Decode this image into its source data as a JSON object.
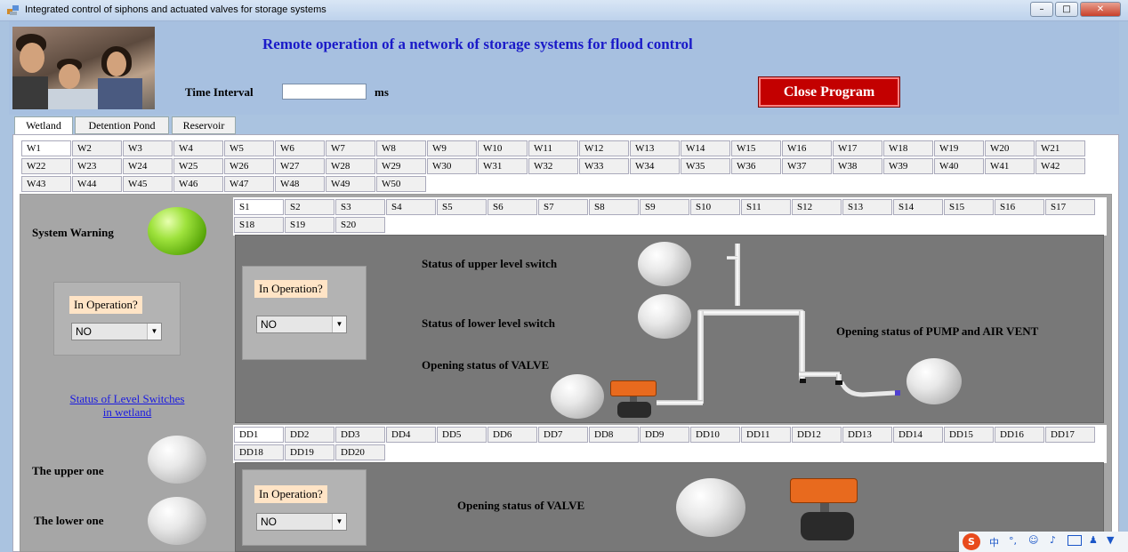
{
  "window": {
    "title": "Integrated control of siphons and actuated valves for storage systems",
    "min": "–",
    "max": "□",
    "close": "✕"
  },
  "header": {
    "title": "Remote operation of a network of storage systems for flood control",
    "time_interval_label": "Time Interval",
    "time_interval_value": "",
    "time_unit": "ms",
    "close_button": "Close Program"
  },
  "main_tabs": [
    "Wetland",
    "Detention Pond",
    "Reservoir"
  ],
  "wetland_tabs": [
    "W1",
    "W2",
    "W3",
    "W4",
    "W5",
    "W6",
    "W7",
    "W8",
    "W9",
    "W10",
    "W11",
    "W12",
    "W13",
    "W14",
    "W15",
    "W16",
    "W17",
    "W18",
    "W19",
    "W20",
    "W21",
    "W22",
    "W23",
    "W24",
    "W25",
    "W26",
    "W27",
    "W28",
    "W29",
    "W30",
    "W31",
    "W32",
    "W33",
    "W34",
    "W35",
    "W36",
    "W37",
    "W38",
    "W39",
    "W40",
    "W41",
    "W42",
    "W43",
    "W44",
    "W45",
    "W46",
    "W47",
    "W48",
    "W49",
    "W50"
  ],
  "left_panel": {
    "system_warning": "System Warning",
    "in_operation": "In Operation?",
    "in_operation_value": "NO",
    "level_switches_link_line1": "Status of Level Switches",
    "level_switches_link_line2": "in wetland",
    "upper_one": "The upper one",
    "lower_one": "The lower one"
  },
  "siphon_tabs": [
    "S1",
    "S2",
    "S3",
    "S4",
    "S5",
    "S6",
    "S7",
    "S8",
    "S9",
    "S10",
    "S11",
    "S12",
    "S13",
    "S14",
    "S15",
    "S16",
    "S17",
    "S18",
    "S19",
    "S20"
  ],
  "siphon_panel": {
    "in_operation": "In Operation?",
    "in_operation_value": "NO",
    "upper_switch": "Status of upper level switch",
    "lower_switch": "Status of lower level switch",
    "valve_status": "Opening status of VALVE",
    "pump_status": "Opening status of PUMP and AIR VENT"
  },
  "dd_tabs": [
    "DD1",
    "DD2",
    "DD3",
    "DD4",
    "DD5",
    "DD6",
    "DD7",
    "DD8",
    "DD9",
    "DD10",
    "DD11",
    "DD12",
    "DD13",
    "DD14",
    "DD15",
    "DD16",
    "DD17",
    "DD18",
    "DD19",
    "DD20"
  ],
  "dd_panel": {
    "in_operation": "In Operation?",
    "in_operation_value": "NO",
    "valve_status": "Opening status of VALVE"
  },
  "tray": {
    "ime_mark": "S",
    "ime_lang": "中"
  }
}
